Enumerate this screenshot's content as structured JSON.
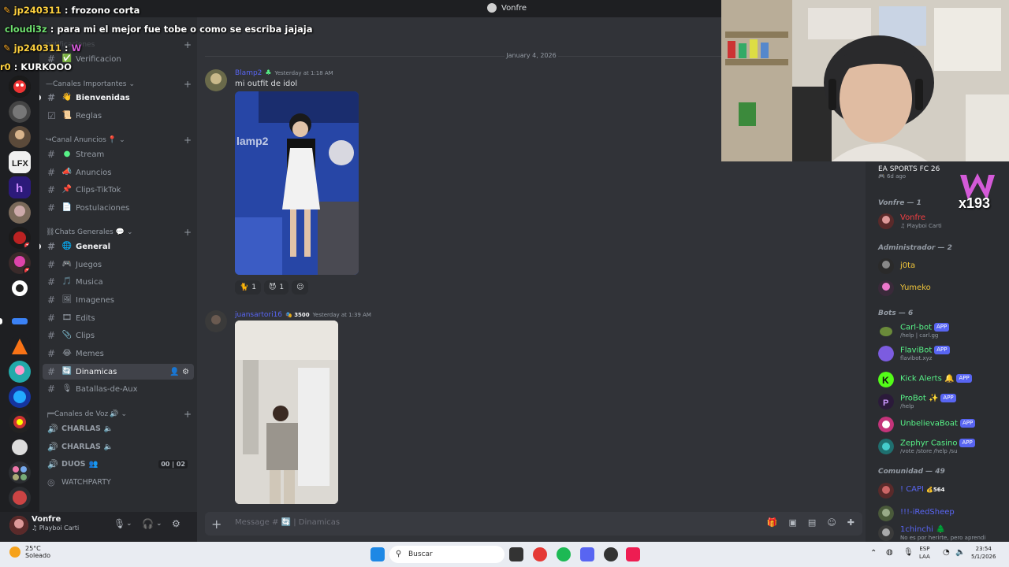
{
  "window": {
    "title": "Vonfre"
  },
  "overlay_chat": [
    {
      "nick": "jp240311",
      "text": ": frozono corta"
    },
    {
      "nick": "cloudi3z",
      "text": ": para mi el mejor fue tobe o como se escriba jajaja"
    },
    {
      "nick": "jp240311",
      "text": ":"
    },
    {
      "nick": "r0",
      "text": ": KURKOOO"
    }
  ],
  "sidebar": {
    "categories": {
      "notifications": "notificaciones",
      "important": "Canales Importantes",
      "announcements": "Canal Anuncios",
      "general": "Chats Generales",
      "voice": "Canales de Voz"
    },
    "channels": {
      "verificacion": "Verificacion",
      "bienvenidas": "Bienvenidas",
      "reglas": "Reglas",
      "stream": "Stream",
      "anuncios": "Anuncios",
      "clips_tiktok": "Clips-TikTok",
      "postulaciones": "Postulaciones",
      "general": "General",
      "juegos": "Juegos",
      "musica": "Musica",
      "imagenes": "Imagenes",
      "edits": "Edits",
      "clips": "Clips",
      "memes": "Memes",
      "dinamicas": "Dinamicas",
      "batallas": "Batallas-de-Aux"
    },
    "voice": {
      "charlas1": "CHARLAS",
      "charlas2": "CHARLAS",
      "duos": "DUOS",
      "duos_count_a": "00",
      "duos_count_b": "02",
      "watchparty": "WATCHPARTY"
    }
  },
  "user_panel": {
    "name": "Vonfre",
    "status": "Playboi Carti"
  },
  "chat": {
    "date_separator": "January 4, 2026",
    "messages": [
      {
        "author": "Blamp2",
        "timestamp": "Yesterday at 1:18 AM",
        "text": "mi outfit de idol",
        "reactions": [
          {
            "emoji": "🐈",
            "count": "1"
          },
          {
            "emoji": "😈",
            "count": "1"
          }
        ]
      },
      {
        "author": "juansartori16",
        "badge": "3500",
        "timestamp": "Yesterday at 1:39 AM"
      }
    ],
    "input_placeholder": "Message #",
    "input_channel": "Dinamicas"
  },
  "members": {
    "activity_game": "EA SPORTS FC 26",
    "activity_time": "6d ago",
    "groups": {
      "vonfre": "Vonfre — 1",
      "admin": "Administrador — 2",
      "bots": "Bots — 6",
      "comunidad": "Comunidad — 49"
    },
    "list": {
      "vonfre": {
        "name": "Vonfre",
        "status": "Playboi Carti",
        "color": "#f23f43"
      },
      "jota": {
        "name": "j0ta",
        "color": "#f0c53b"
      },
      "yumeko": {
        "name": "Yumeko",
        "color": "#f0c53b"
      },
      "carlbot": {
        "name": "Carl-bot",
        "status": "/help | carl.gg",
        "color": "#57f287"
      },
      "flavibot": {
        "name": "FlaviBot",
        "status": "flavibot.xyz",
        "color": "#57f287"
      },
      "kickalerts": {
        "name": "Kick Alerts",
        "color": "#57f287"
      },
      "probot": {
        "name": "ProBot",
        "status": "/help",
        "color": "#57f287"
      },
      "unbelievaboat": {
        "name": "UnbelievaBoat",
        "color": "#57f287"
      },
      "zephyr": {
        "name": "Zephyr Casino",
        "status": "/vote /store /help /su",
        "color": "#57f287"
      },
      "capi": {
        "name": "! CAPI",
        "badge": "564",
        "color": "#5865f2"
      },
      "iredsheep": {
        "name": "!!!-iRedSheep",
        "color": "#5865f2"
      },
      "ichinchi": {
        "name": "1chinchi",
        "status": "No es por herirte, pero aprendi",
        "color": "#5865f2"
      }
    },
    "app_label": "APP"
  },
  "overlay_badge": {
    "count": "x193"
  },
  "taskbar": {
    "temp": "25°C",
    "weather": "Soleado",
    "search": "Buscar",
    "lang": "ESP",
    "lang2": "LAA",
    "time": "23:54",
    "date": "5/1/2026"
  }
}
